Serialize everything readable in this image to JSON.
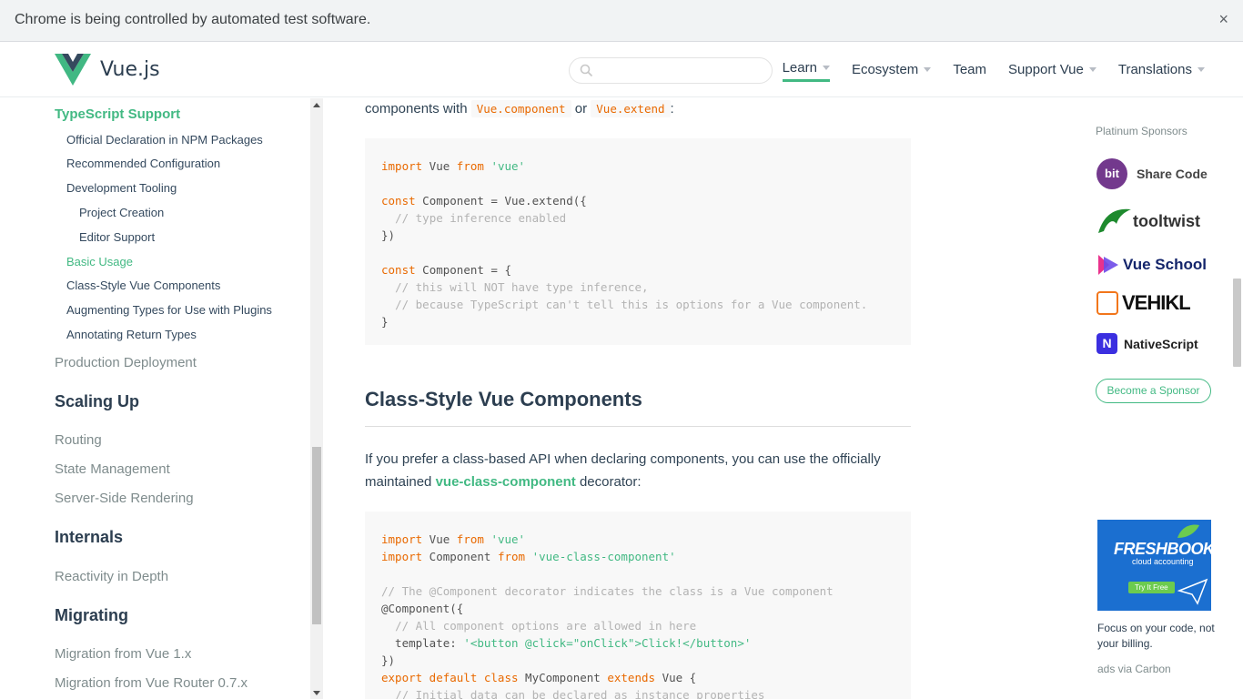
{
  "infobar": {
    "text": "Chrome is being controlled by automated test software.",
    "close": "×"
  },
  "header": {
    "logo_text": "Vue.js",
    "search_placeholder": "",
    "nav": [
      {
        "label": "Learn",
        "dropdown": true,
        "active": true
      },
      {
        "label": "Ecosystem",
        "dropdown": true
      },
      {
        "label": "Team",
        "dropdown": false
      },
      {
        "label": "Support Vue",
        "dropdown": true
      },
      {
        "label": "Translations",
        "dropdown": true
      }
    ]
  },
  "sidebar": {
    "typescript_support": "TypeScript Support",
    "items": [
      "Official Declaration in NPM Packages",
      "Recommended Configuration",
      "Development Tooling",
      "Project Creation",
      "Editor Support",
      "Basic Usage",
      "Class-Style Vue Components",
      "Augmenting Types for Use with Plugins",
      "Annotating Return Types"
    ],
    "production_deployment": "Production Deployment",
    "scaling_up": "Scaling Up",
    "routing": "Routing",
    "state_management": "State Management",
    "ssr": "Server-Side Rendering",
    "internals": "Internals",
    "reactivity": "Reactivity in Depth",
    "migrating": "Migrating",
    "migration_vue1": "Migration from Vue 1.x",
    "migration_router": "Migration from Vue Router 0.7.x"
  },
  "content": {
    "intro_prefix": "components with",
    "intro_code1": "Vue.component",
    "intro_or": "or",
    "intro_code2": "Vue.extend",
    "intro_suffix": ":",
    "heading": "Class-Style Vue Components",
    "para_prefix": "If you prefer a class-based API when declaring components, you can use the officially maintained",
    "para_link": "vue-class-component",
    "para_suffix": "decorator:"
  },
  "sponsors": {
    "title": "Platinum Sponsors",
    "items": [
      "Share Code",
      "tooltwist",
      "Vue School",
      "VEHIKL",
      "NativeScript"
    ],
    "bit_label": "bit",
    "become": "Become a Sponsor"
  },
  "ad": {
    "brand": "FRESHBOOKS",
    "sub": "cloud accounting",
    "button": "Try It Free",
    "text": "Focus on your code, not your billing.",
    "via": "ads via Carbon"
  },
  "colors": {
    "accent": "#42b983",
    "text": "#2c3e50",
    "keyword": "#e96900",
    "comment": "#b3b3b3"
  }
}
